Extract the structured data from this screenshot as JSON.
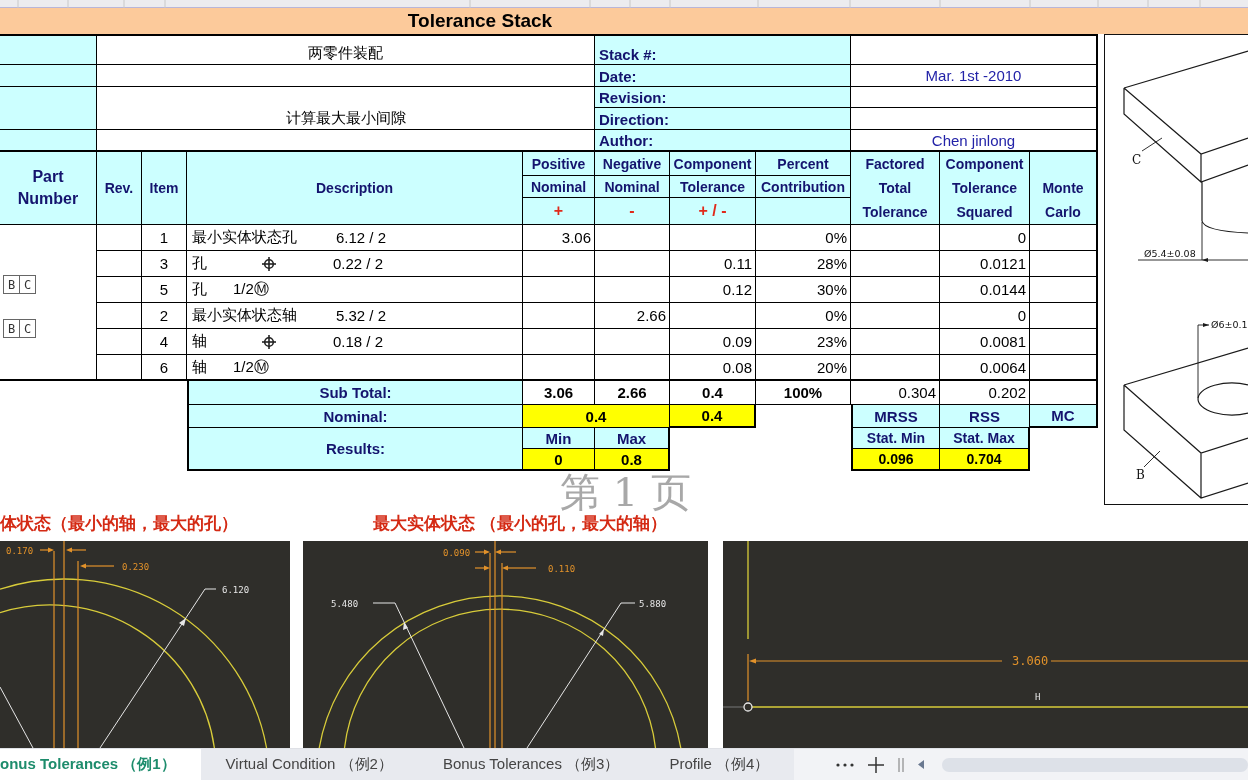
{
  "title": "Tolerance Stack",
  "info": {
    "subject": "两零件装配",
    "purpose": "计算最大最小间隙",
    "fields": [
      {
        "label": "Stack #:"
      },
      {
        "label": "Date:",
        "value": "Mar. 1st -2010"
      },
      {
        "label": "Revision:"
      },
      {
        "label": "Direction:"
      },
      {
        "label": "Author:",
        "value": "Chen jinlong"
      }
    ]
  },
  "table": {
    "columns": [
      {
        "kind": "merged",
        "label": "Part Number"
      },
      {
        "kind": "merged",
        "label": "Rev."
      },
      {
        "kind": "merged",
        "label": "Item"
      },
      {
        "kind": "merged",
        "label": "Description"
      },
      {
        "kind": "split",
        "lines": [
          "Positive",
          "Nominal"
        ],
        "sign": "+"
      },
      {
        "kind": "split",
        "lines": [
          "Negative",
          "Nominal"
        ],
        "sign": "-"
      },
      {
        "kind": "split",
        "lines": [
          "Component",
          "Tolerance"
        ],
        "sign": "+ / -"
      },
      {
        "kind": "split",
        "lines": [
          "Percent",
          "Contribution"
        ]
      },
      {
        "kind": "stacked",
        "label": "Factored Total Tolerance"
      },
      {
        "kind": "stacked",
        "label": "Component Tolerance Squared"
      },
      {
        "kind": "stacked",
        "label": "Monte Carlo"
      }
    ],
    "datum_frames": [
      [
        "B",
        "C"
      ],
      [
        "B",
        "C"
      ]
    ],
    "rows": [
      {
        "item": "1",
        "description": {
          "kind": "dimension",
          "name": "最小实体状态孔",
          "value": "6.12 / 2"
        },
        "positive": "3.06",
        "percent": "0%",
        "squared": "0"
      },
      {
        "item": "3",
        "description": {
          "kind": "position",
          "name": "孔",
          "value": "0.22 / 2"
        },
        "tolerance": "0.11",
        "percent": "28%",
        "squared": "0.0121"
      },
      {
        "item": "5",
        "description": {
          "kind": "bonus",
          "name": "孔",
          "value": "1/2Ⓜ"
        },
        "tolerance": "0.12",
        "percent": "30%",
        "squared": "0.0144"
      },
      {
        "item": "2",
        "description": {
          "kind": "dimension",
          "name": "最小实体状态轴",
          "value": "5.32 / 2"
        },
        "negative": "2.66",
        "percent": "0%",
        "squared": "0"
      },
      {
        "item": "4",
        "description": {
          "kind": "position",
          "name": "轴",
          "value": "0.18 / 2"
        },
        "tolerance": "0.09",
        "percent": "23%",
        "squared": "0.0081"
      },
      {
        "item": "6",
        "description": {
          "kind": "bonus",
          "name": "轴",
          "value": "1/2Ⓜ"
        },
        "tolerance": "0.08",
        "percent": "20%",
        "squared": "0.0064"
      }
    ]
  },
  "summary": {
    "subtotal": {
      "label": "Sub Total:",
      "positive": "3.06",
      "negative": "2.66",
      "tolerance": "0.4",
      "percent": "100%",
      "factored": "0.304",
      "squared": "0.202"
    },
    "nominal": {
      "label": "Nominal:",
      "value": "0.4",
      "tolerance": "0.4"
    },
    "results": {
      "label": "Results:",
      "min_label": "Min",
      "min": "0",
      "max_label": "Max",
      "max": "0.8"
    },
    "statistics": [
      {
        "label": "MRSS",
        "sub_label": "Stat. Min",
        "value": "0.096"
      },
      {
        "label": "RSS",
        "sub_label": "Stat. Max",
        "value": "0.704"
      },
      {
        "label": "MC"
      }
    ]
  },
  "part_drawing": {
    "upper_label": "C",
    "upper_dimension": "Ø5.4±0.08",
    "lower_dimension": "Ø6±0.1",
    "lower_label": "B"
  },
  "page_label": "第 1 页",
  "figures": [
    {
      "kind": "least_material",
      "caption": "体状态（最小的轴，最大的孔）",
      "labels": [
        "0.170",
        "0.230",
        "6.120"
      ]
    },
    {
      "kind": "max_material",
      "caption": "最大实体状态 （最小的孔，最大的轴）",
      "labels": [
        "0.090",
        "0.110",
        "5.480",
        "5.880"
      ]
    },
    {
      "kind": "length",
      "labels": [
        "3.060",
        "H"
      ]
    }
  ],
  "sheet_tabs": [
    {
      "label": "onus Tolerances （例1）",
      "selected": true
    },
    {
      "label": "Virtual Condition （例2）",
      "selected": false
    },
    {
      "label": "Bonus Tolerances （例3）",
      "selected": false
    },
    {
      "label": "Profile （例4）",
      "selected": false
    }
  ]
}
